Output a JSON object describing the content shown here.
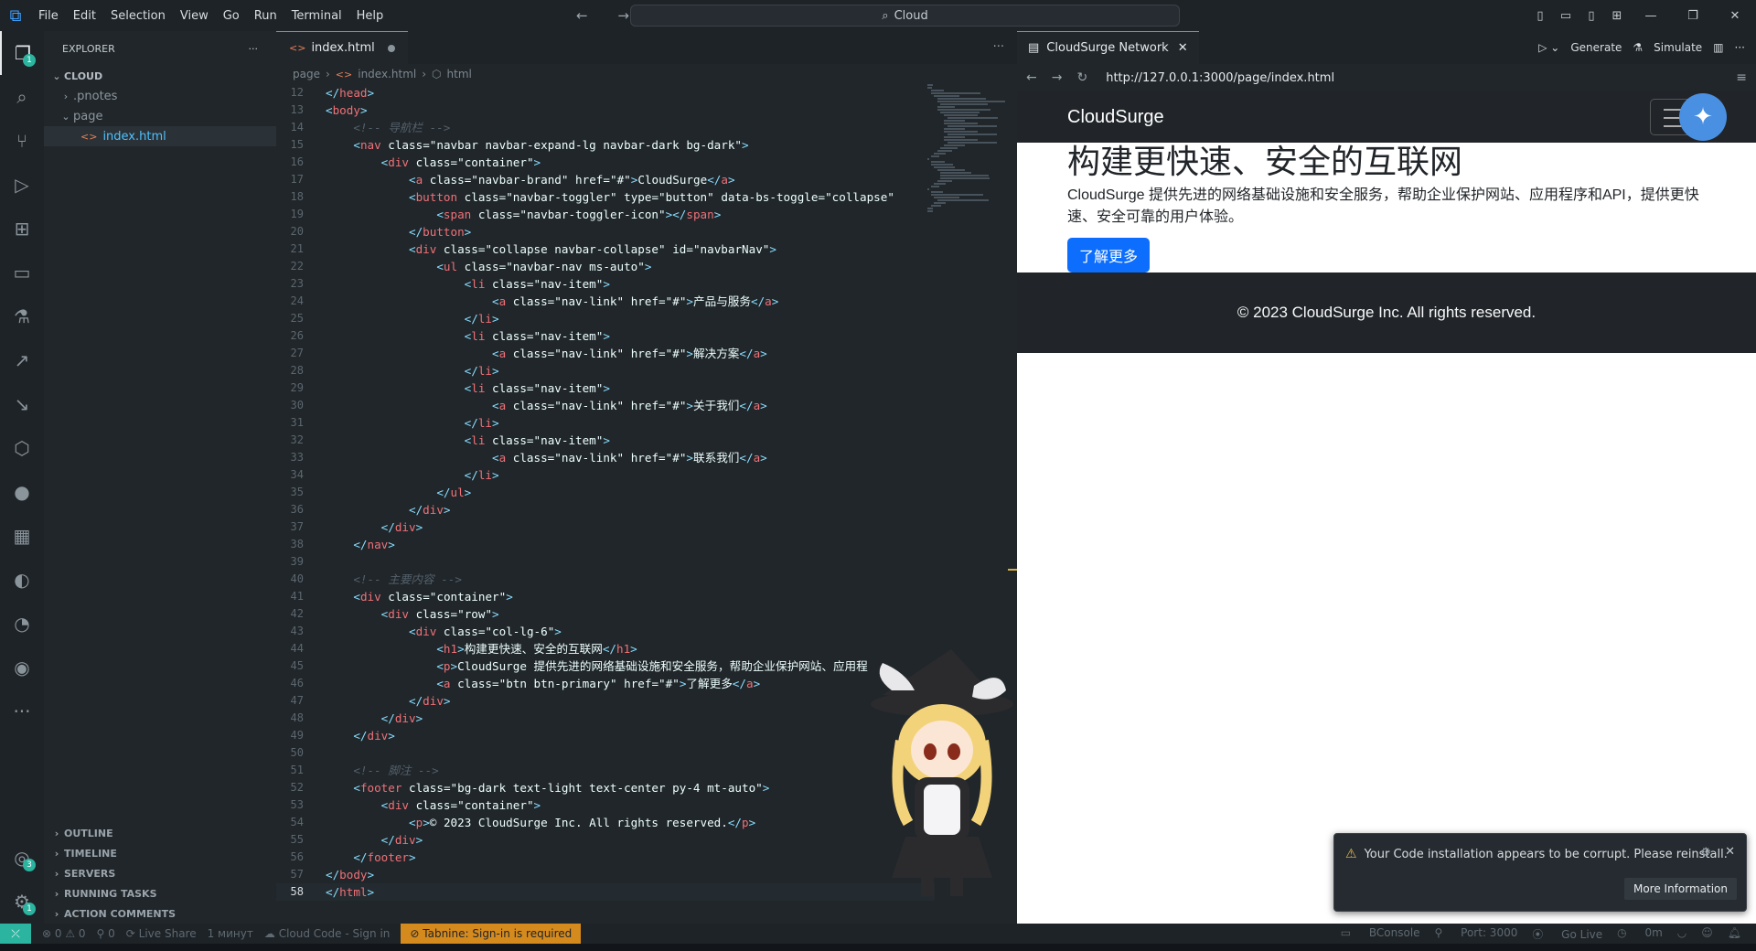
{
  "menu": [
    "File",
    "Edit",
    "Selection",
    "View",
    "Go",
    "Run",
    "Terminal",
    "Help"
  ],
  "command_center": "Cloud",
  "explorer": {
    "title": "EXPLORER",
    "root": "CLOUD",
    "items": [
      ".pnotes",
      "page",
      "index.html"
    ],
    "bottom_sections": [
      "OUTLINE",
      "TIMELINE",
      "SERVERS",
      "RUNNING TASKS",
      "ACTION COMMENTS"
    ]
  },
  "activity_badges": {
    "explorer": "1",
    "accounts": "3",
    "manage": "1"
  },
  "editor": {
    "tab_label": "index.html",
    "breadcrumb": [
      "page",
      "index.html",
      "html"
    ],
    "first_line_number": 12,
    "lines": [
      "</head>",
      "<body>",
      "    <!-- 导航栏 -->",
      "    <nav class=\"navbar navbar-expand-lg navbar-dark bg-dark\">",
      "        <div class=\"container\">",
      "            <a class=\"navbar-brand\" href=\"#\">CloudSurge</a>",
      "            <button class=\"navbar-toggler\" type=\"button\" data-bs-toggle=\"collapse\"",
      "                <span class=\"navbar-toggler-icon\"></span>",
      "            </button>",
      "            <div class=\"collapse navbar-collapse\" id=\"navbarNav\">",
      "                <ul class=\"navbar-nav ms-auto\">",
      "                    <li class=\"nav-item\">",
      "                        <a class=\"nav-link\" href=\"#\">产品与服务</a>",
      "                    </li>",
      "                    <li class=\"nav-item\">",
      "                        <a class=\"nav-link\" href=\"#\">解决方案</a>",
      "                    </li>",
      "                    <li class=\"nav-item\">",
      "                        <a class=\"nav-link\" href=\"#\">关于我们</a>",
      "                    </li>",
      "                    <li class=\"nav-item\">",
      "                        <a class=\"nav-link\" href=\"#\">联系我们</a>",
      "                    </li>",
      "                </ul>",
      "            </div>",
      "        </div>",
      "    </nav>",
      "",
      "    <!-- 主要内容 -->",
      "    <div class=\"container\">",
      "        <div class=\"row\">",
      "            <div class=\"col-lg-6\">",
      "                <h1>构建更快速、安全的互联网</h1>",
      "                <p>CloudSurge 提供先进的网络基础设施和安全服务，帮助企业保护网站、应用程",
      "                <a class=\"btn btn-primary\" href=\"#\">了解更多</a>",
      "            </div>",
      "        </div>",
      "    </div>",
      "",
      "    <!-- 脚注 -->",
      "    <footer class=\"bg-dark text-light text-center py-4 mt-auto\">",
      "        <div class=\"container\">",
      "            <p>© 2023 CloudSurge Inc. All rights reserved.</p>",
      "        </div>",
      "    </footer>",
      "</body>",
      "</html>"
    ]
  },
  "preview": {
    "tab_label": "CloudSurge Network",
    "generate_label": "Generate",
    "simulate_label": "Simulate",
    "url": "http://127.0.0.1:3000/page/index.html",
    "site": {
      "brand": "CloudSurge",
      "heading": "构建更快速、安全的互联网",
      "paragraph": "CloudSurge 提供先进的网络基础设施和安全服务，帮助企业保护网站、应用程序和API，提供更快速、安全可靠的用户体验。",
      "button": "了解更多",
      "footer": "© 2023 CloudSurge Inc. All rights reserved."
    }
  },
  "toast": {
    "message": "Your Code installation appears to be corrupt. Please reinstall.",
    "button": "More Information"
  },
  "status": {
    "problems": "⊗ 0 ⚠ 0",
    "ports": "⚲ 0",
    "live_share": "Live Share",
    "time": "1 минут",
    "cloud_code": "Cloud Code - Sign in",
    "tabnine": "Tabnine: Sign-in is required",
    "bconsole": "BConsole",
    "port": "Port: 3000",
    "go_live": "Go Live",
    "timer": "0m"
  }
}
